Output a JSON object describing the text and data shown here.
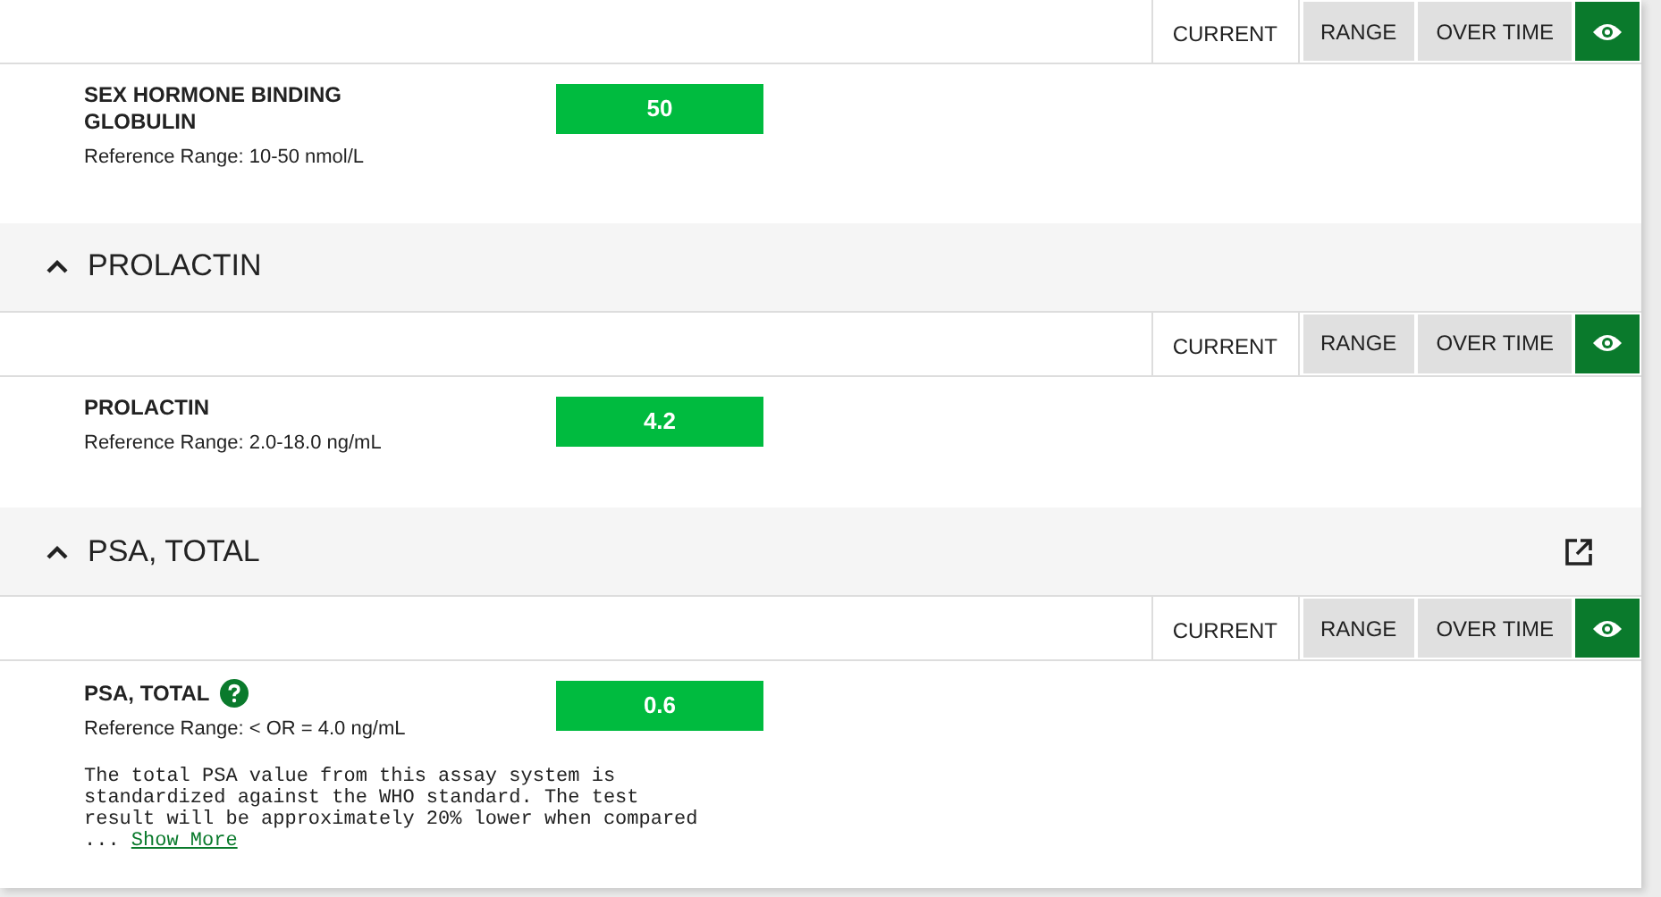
{
  "sections": [
    {
      "tabs": [
        {
          "label": "CURRENT",
          "selected": true
        },
        {
          "label": "RANGE",
          "selected": false
        },
        {
          "label": "OVER TIME",
          "selected": false
        }
      ],
      "results": [
        {
          "name": "SEX HORMONE BINDING GLOBULIN",
          "reference": "Reference Range: 10-50 nmol/L",
          "value": "50",
          "help": false
        }
      ]
    },
    {
      "title": "PROLACTIN",
      "expanded": true,
      "external_link": false,
      "tabs": [
        {
          "label": "CURRENT",
          "selected": true
        },
        {
          "label": "RANGE",
          "selected": false
        },
        {
          "label": "OVER TIME",
          "selected": false
        }
      ],
      "results": [
        {
          "name": "PROLACTIN",
          "reference": "Reference Range: 2.0-18.0 ng/mL",
          "value": "4.2",
          "help": false
        }
      ]
    },
    {
      "title": "PSA, TOTAL",
      "expanded": true,
      "external_link": true,
      "tabs": [
        {
          "label": "CURRENT",
          "selected": true
        },
        {
          "label": "RANGE",
          "selected": false
        },
        {
          "label": "OVER TIME",
          "selected": false
        }
      ],
      "results": [
        {
          "name": "PSA, TOTAL",
          "reference": "Reference Range: < OR = 4.0 ng/mL",
          "value": "0.6",
          "help": true,
          "note": "The total PSA value from this assay system is standardized against the WHO standard. The test result will be approximately 20% lower when compared ...",
          "show_more": "Show More"
        }
      ]
    }
  ]
}
